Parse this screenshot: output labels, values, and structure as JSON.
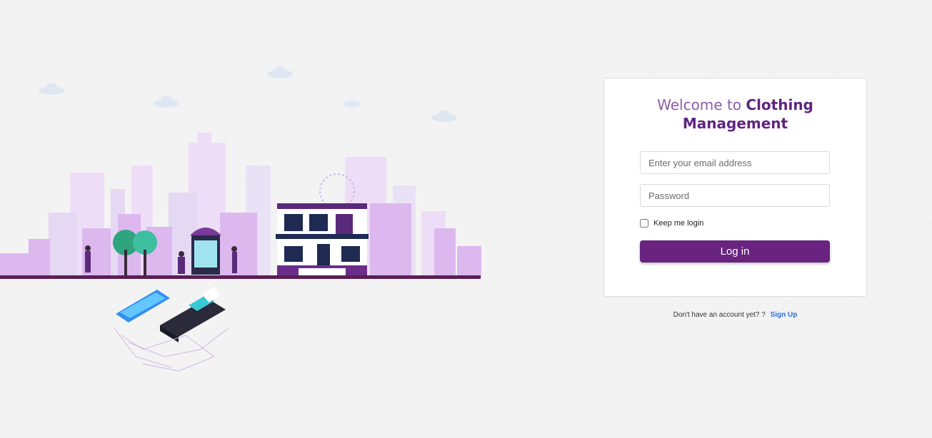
{
  "login": {
    "title_prefix": "Welcome to ",
    "title_brand": "Clothing Management",
    "email_placeholder": "Enter your email address",
    "password_placeholder": "Password",
    "keep_login_label": "Keep me login",
    "login_button": "Log in"
  },
  "signup": {
    "prompt": "Don't have an account yet? ?",
    "link_label": "Sign Up"
  },
  "colors": {
    "accent": "#68247f",
    "link": "#2f6fd6",
    "skyline_light": "#eeddf7",
    "skyline_mid": "#dcb8ef"
  },
  "illustration": {
    "icons": [
      "city-skyline",
      "tree-icon",
      "shop-kiosk-icon",
      "house-icon",
      "card-terminal-icon",
      "smartphone-icon",
      "person-icon"
    ]
  }
}
